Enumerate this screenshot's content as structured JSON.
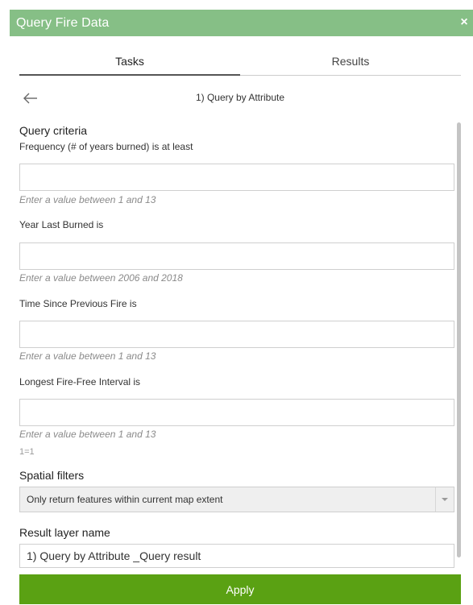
{
  "window": {
    "title": "Query Fire Data",
    "close_label": "×"
  },
  "tabs": [
    {
      "label": "Tasks",
      "active": true
    },
    {
      "label": "Results",
      "active": false
    }
  ],
  "subheader": {
    "back_icon": "arrow-left-icon",
    "title": "1) Query by Attribute"
  },
  "query_criteria": {
    "heading": "Query criteria",
    "fields": [
      {
        "label": "Frequency (# of years burned) is at least",
        "value": "",
        "hint": "Enter a value between 1 and 13"
      },
      {
        "label": "Year Last Burned is",
        "value": "",
        "hint": "Enter a value between 2006 and 2018"
      },
      {
        "label": "Time Since Previous Fire is",
        "value": "",
        "hint": "Enter a value between 1 and 13"
      },
      {
        "label": "Longest Fire-Free Interval is",
        "value": "",
        "hint": "Enter a value between 1 and 13"
      }
    ],
    "expression": "1=1"
  },
  "spatial_filters": {
    "heading": "Spatial filters",
    "selected": "Only return features within current map extent",
    "arrow_icon": "caret-down-icon"
  },
  "result_layer": {
    "heading": "Result layer name",
    "value": "1) Query by Attribute _Query result"
  },
  "actions": {
    "apply_label": "Apply"
  },
  "colors": {
    "titlebar": "#86bf86",
    "apply": "#5aa113",
    "hint": "#8a8a8a"
  }
}
